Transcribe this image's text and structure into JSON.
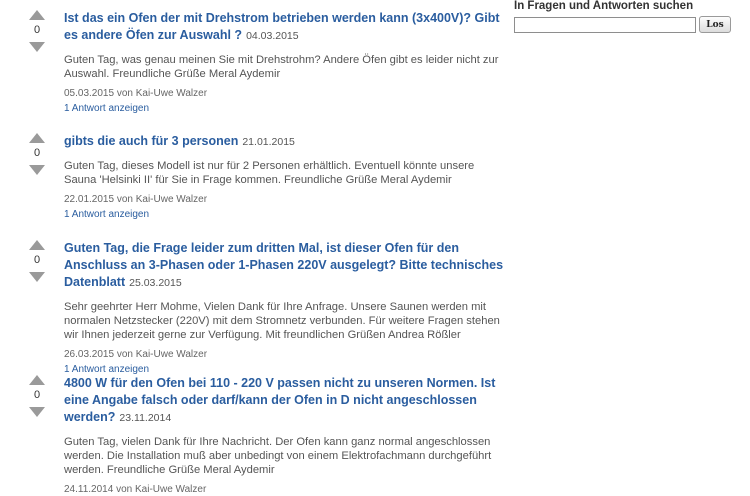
{
  "sidebar": {
    "search_title": "In Fragen und Antworten suchen",
    "search_value": "",
    "search_button": "Los"
  },
  "items": [
    {
      "votes": "0",
      "question": "Ist das ein Ofen der mit Drehstrom betrieben werden kann (3x400V)? Gibt es andere Öfen zur Auswahl ?",
      "question_date": "04.03.2015",
      "answer": "Guten Tag, was genau meinen Sie mit Drehstrohm? Andere Öfen gibt es leider nicht zur Auswahl. Freundliche Grüße Meral Aydemir",
      "meta": "05.03.2015 von Kai-Uwe Walzer",
      "toggle": "1 Antwort anzeigen"
    },
    {
      "votes": "0",
      "question": "gibts die auch für 3 personen",
      "question_date": "21.01.2015",
      "answer": "Guten Tag, dieses Modell ist nur für 2 Personen erhältlich. Eventuell könnte unsere Sauna 'Helsinki II' für Sie in Frage kommen. Freundliche Grüße Meral Aydemir",
      "meta": "22.01.2015 von Kai-Uwe Walzer",
      "toggle": "1 Antwort anzeigen"
    },
    {
      "votes": "0",
      "question": "Guten Tag, die Frage leider zum dritten Mal, ist dieser Ofen für den Anschluss an 3-Phasen oder 1-Phasen 220V ausgelegt? Bitte technisches Datenblatt",
      "question_date": "25.03.2015",
      "answer": "Sehr geehrter Herr Mohme, Vielen Dank für Ihre Anfrage. Unsere Saunen werden mit normalen Netzstecker (220V) mit dem Stromnetz verbunden. Für weitere Fragen stehen wir Ihnen jederzeit gerne zur Verfügung. Mit freundlichen Grüßen Andrea Rößler",
      "meta": "26.03.2015 von Kai-Uwe Walzer",
      "toggle": "1 Antwort anzeigen"
    },
    {
      "votes": "0",
      "question": "4800 W für den Ofen bei 110 - 220 V passen nicht zu unseren Normen. Ist eine Angabe falsch oder darf/kann der Ofen in D nicht angeschlossen werden?",
      "question_date": "23.11.2014",
      "answer": "Guten Tag, vielen Dank für Ihre Nachricht. Der Ofen kann ganz normal angeschlossen werden. Die Installation muß aber unbedingt von einem Elektrofachmann durchgeführt werden. Freundliche Grüße Meral Aydemir",
      "meta": "24.11.2014 von Kai-Uwe Walzer",
      "toggle": ""
    }
  ]
}
